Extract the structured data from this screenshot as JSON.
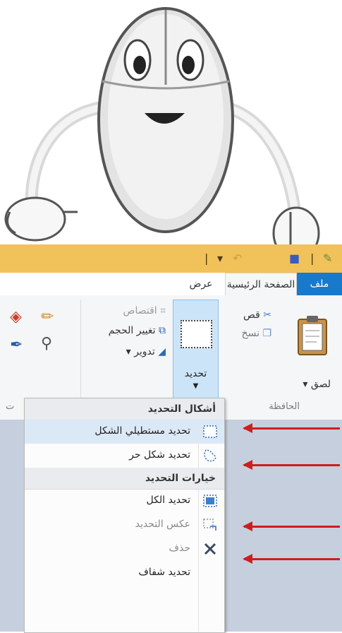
{
  "ribbon": {
    "tabs": {
      "file": "ملف",
      "home": "الصفحة الرئيسية",
      "view": "عرض"
    },
    "clipboard": {
      "paste": "لصق",
      "cut": "قص",
      "copy": "نسخ",
      "group_label": "الحافظة"
    },
    "image": {
      "select": "تحديد",
      "crop": "اقتصاص",
      "resize": "تغيير الحجم",
      "rotate": "تدوير",
      "group_label_partial": "ت"
    }
  },
  "menu": {
    "section_shapes": "أشكال التحديد",
    "rect_select": "تحديد مستطيلي الشكل",
    "free_select": "تحديد شكل حر",
    "section_options": "خيارات التحديد",
    "select_all": "تحديد الكل",
    "invert_select": "عكس التحديد",
    "delete": "حذف",
    "transparent_select": "تحديد شفاف"
  },
  "colors": {
    "file_tab": "#1979ca",
    "titlebar": "#f1c15a",
    "arrow": "#cc1f1f",
    "desktop": "#c6cfdd",
    "select_highlight": "#cce4f7"
  },
  "icons": [
    "scissors-icon",
    "copy-icon",
    "clipboard-icon",
    "crop-icon",
    "resize-icon",
    "rotate-icon",
    "pencil-icon",
    "fill-bucket-icon",
    "color-picker-icon",
    "magnifier-icon",
    "rect-select-icon",
    "free-select-icon",
    "select-all-icon",
    "invert-select-icon",
    "delete-icon"
  ]
}
